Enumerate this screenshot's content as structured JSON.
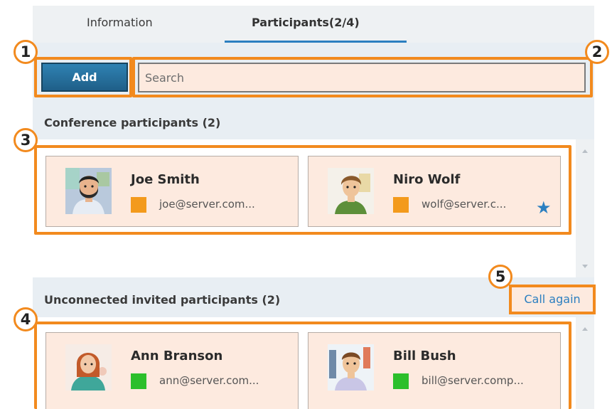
{
  "tabs": {
    "information": "Information",
    "participants": "Participants(2/4)"
  },
  "toolbar": {
    "add_label": "Add",
    "search_placeholder": "Search"
  },
  "badges": [
    "1",
    "2",
    "3",
    "4",
    "5"
  ],
  "sections": {
    "conference": {
      "title": "Conference participants (2)",
      "participants": [
        {
          "name": "Joe Smith",
          "email": "joe@server.com...",
          "status_color": "#f39a1c",
          "starred": false
        },
        {
          "name": "Niro Wolf",
          "email": "wolf@server.c...",
          "status_color": "#f39a1c",
          "starred": true
        }
      ]
    },
    "unconnected": {
      "title": "Unconnected invited participants (2)",
      "call_again_label": "Call again",
      "participants": [
        {
          "name": "Ann Branson",
          "email": "ann@server.com...",
          "status_color": "#2bbf2b"
        },
        {
          "name": "Bill Bush",
          "email": "bill@server.comp...",
          "status_color": "#2bbf2b"
        }
      ]
    }
  },
  "colors": {
    "accent": "#2b7fc0",
    "highlight": "#f28a1e",
    "card_bg": "#fdeadf"
  },
  "icons": {
    "favorite": "star-icon"
  }
}
